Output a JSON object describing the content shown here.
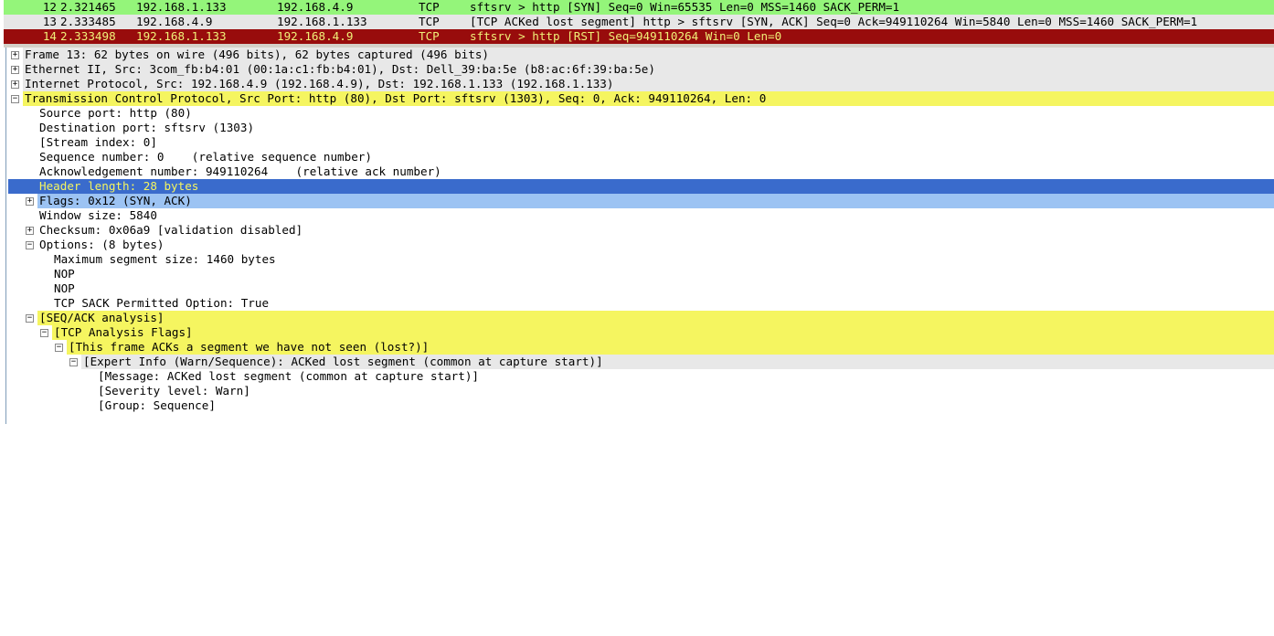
{
  "packet_list": {
    "rows": [
      {
        "no": "12",
        "time": "2.321465",
        "source": "192.168.1.133",
        "destination": "192.168.4.9",
        "protocol": "TCP",
        "info": "sftsrv > http [SYN] Seq=0 Win=65535 Len=0 MSS=1460 SACK_PERM=1",
        "bg": "#94f57a",
        "fg": "#000000"
      },
      {
        "no": "13",
        "time": "2.333485",
        "source": "192.168.4.9",
        "destination": "192.168.1.133",
        "protocol": "TCP",
        "info": "[TCP ACKed lost segment] http > sftsrv [SYN, ACK] Seq=0 Ack=949110264 Win=5840 Len=0 MSS=1460 SACK_PERM=1",
        "bg": "#e6e6e6",
        "fg": "#000000"
      },
      {
        "no": "14",
        "time": "2.333498",
        "source": "192.168.1.133",
        "destination": "192.168.4.9",
        "protocol": "TCP",
        "info": "sftsrv > http [RST] Seq=949110264 Win=0 Len=0",
        "bg": "#980c0c",
        "fg": "#f0f078"
      }
    ]
  },
  "details": {
    "frame": "Frame 13: 62 bytes on wire (496 bits), 62 bytes captured (496 bits)",
    "ethernet": "Ethernet II, Src: 3com_fb:b4:01 (00:1a:c1:fb:b4:01), Dst: Dell_39:ba:5e (b8:ac:6f:39:ba:5e)",
    "ip": "Internet Protocol, Src: 192.168.4.9 (192.168.4.9), Dst: 192.168.1.133 (192.168.1.133)",
    "tcp": "Transmission Control Protocol, Src Port: http (80), Dst Port: sftsrv (1303), Seq: 0, Ack: 949110264, Len: 0",
    "source_port": "Source port: http (80)",
    "destination_port": "Destination port: sftsrv (1303)",
    "stream_index": "[Stream index: 0]",
    "sequence_number": "Sequence number: 0    (relative sequence number)",
    "ack_number": "Acknowledgement number: 949110264    (relative ack number)",
    "header_length": "Header length: 28 bytes",
    "flags": "Flags: 0x12 (SYN, ACK)",
    "window_size": "Window size: 5840",
    "checksum": "Checksum: 0x06a9 [validation disabled]",
    "options": "Options: (8 bytes)",
    "mss": "Maximum segment size: 1460 bytes",
    "nop1": "NOP",
    "nop2": "NOP",
    "sack_permitted": "TCP SACK Permitted Option: True",
    "seq_ack_analysis": "[SEQ/ACK analysis]",
    "analysis_flags": "[TCP Analysis Flags]",
    "acks_unseen": "[This frame ACKs a segment we have not seen (lost?)]",
    "expert_info": "[Expert Info (Warn/Sequence): ACKed lost segment (common at capture start)]",
    "message": "[Message: ACKed lost segment (common at capture start)]",
    "severity": "[Severity level: Warn]",
    "group": "[Group: Sequence]"
  },
  "icons": {
    "expand": "plus-box-icon",
    "collapse": "minus-box-icon"
  },
  "colors": {
    "syn_row": "#94f57a",
    "selected_packet_row": "#e6e6e6",
    "rst_row": "#980c0c",
    "highlight_yellow": "#f5f560",
    "selected_field": "#3a6bcc",
    "flags_field": "#9cc3f3"
  }
}
